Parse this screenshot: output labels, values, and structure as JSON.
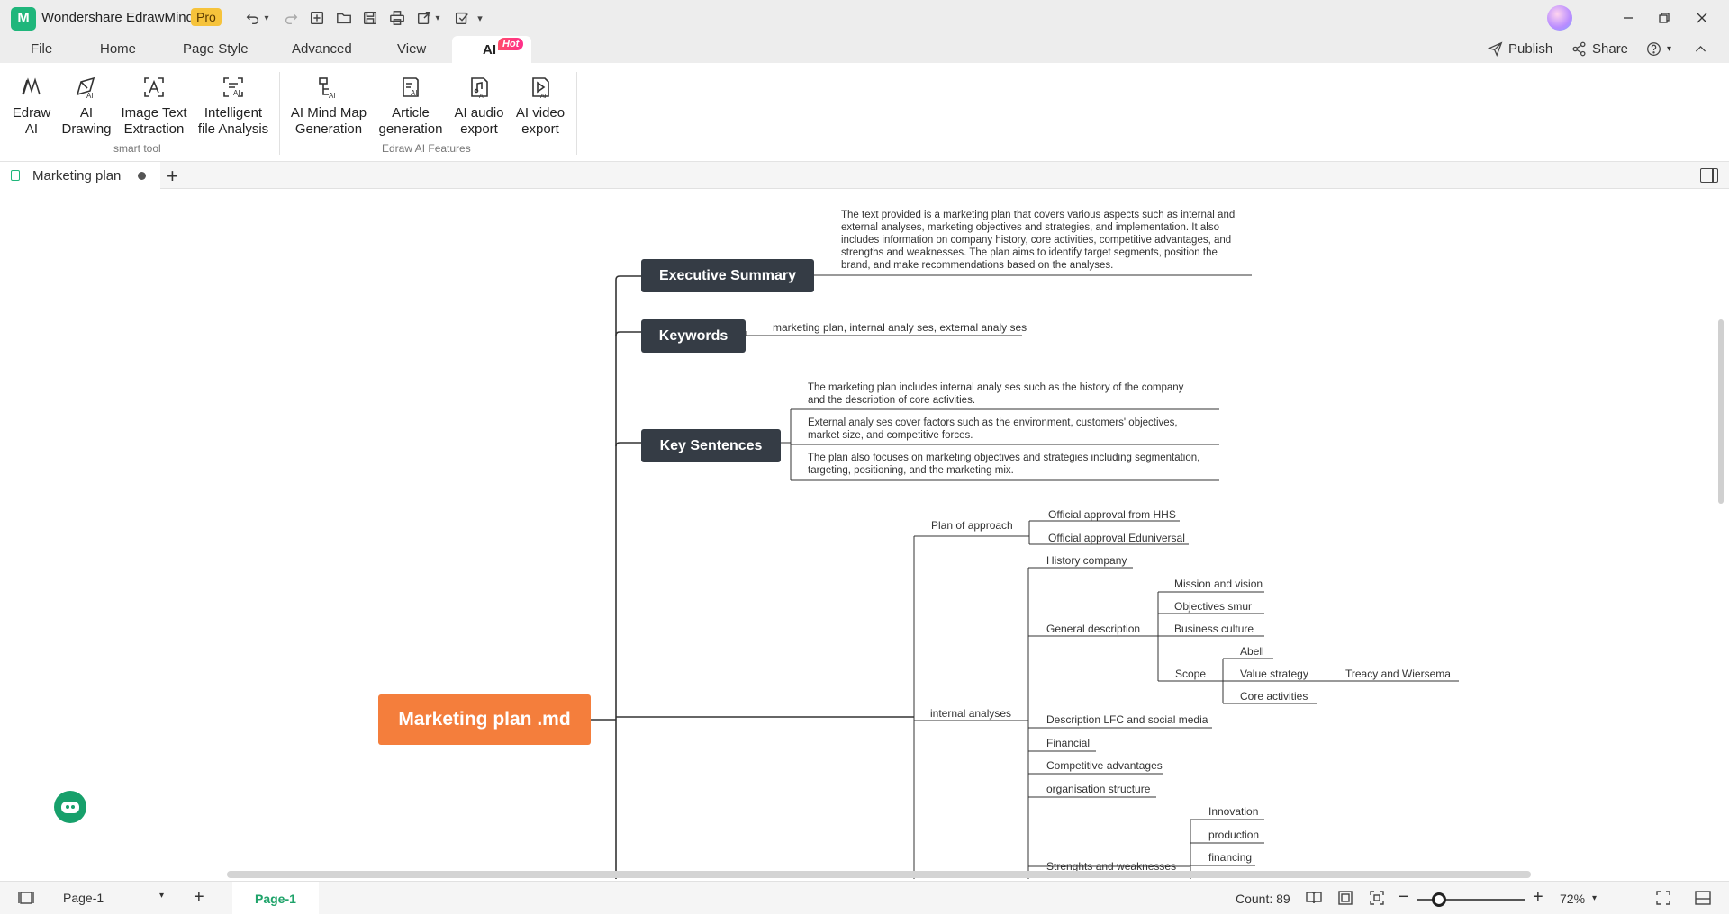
{
  "app": {
    "title": "Wondershare EdrawMind",
    "edition": "Pro",
    "logo_glyph": "M"
  },
  "quick_access": [
    "undo-icon",
    "redo-icon",
    "new-icon",
    "open-icon",
    "save-icon",
    "print-icon",
    "export-icon",
    "checklist-icon",
    "more-icon"
  ],
  "menu": {
    "items": [
      "File",
      "Home",
      "Page Style",
      "Advanced",
      "View"
    ],
    "active": "AI",
    "hot_badge": "Hot",
    "publish": "Publish",
    "share": "Share"
  },
  "ribbon": {
    "groups": [
      {
        "label": "smart tool",
        "buttons": [
          {
            "line1": "Edraw",
            "line2": "AI"
          },
          {
            "line1": "AI",
            "line2": "Drawing"
          },
          {
            "line1": "Image Text",
            "line2": "Extraction"
          },
          {
            "line1": "Intelligent",
            "line2": "file Analysis"
          }
        ]
      },
      {
        "label": "Edraw AI Features",
        "buttons": [
          {
            "line1": "AI Mind Map",
            "line2": "Generation"
          },
          {
            "line1": "Article",
            "line2": "generation"
          },
          {
            "line1": "AI audio",
            "line2": "export"
          },
          {
            "line1": "AI video",
            "line2": "export"
          }
        ]
      }
    ]
  },
  "document_tab": {
    "label": "Marketing plan",
    "add": "+"
  },
  "mindmap": {
    "central": "Marketing plan .md",
    "executive_summary": {
      "label": "Executive Summary",
      "text": [
        "The text provided is a marketing plan that covers various aspects such as internal and",
        "external analyses, marketing objectives and strategies, and implementation. It also",
        "includes information on company history, core activities, competitive advantages, and",
        "strengths and weaknesses. The plan aims to identify target segments, position the",
        "brand, and make recommendations based on the analyses."
      ]
    },
    "keywords": {
      "label": "Keywords",
      "text": "marketing plan, internal analy ses, external analy ses"
    },
    "key_sentences": {
      "label": "Key Sentences",
      "items": [
        [
          "The marketing plan includes internal analy ses such as the history of the company",
          "and the description of core activities."
        ],
        [
          "External analy ses cover factors such as the environment, customers' objectives,",
          "market size, and competitive forces."
        ],
        [
          "The plan also focuses on marketing objectives and strategies including segmentation,",
          "targeting, positioning, and the marketing mix."
        ]
      ]
    },
    "plan_of_approach": {
      "label": "Plan of approach",
      "children": [
        "Official approval from HHS",
        "Official approval Eduniversal"
      ]
    },
    "internal_analyses": {
      "label": "internal analyses",
      "history": "History company",
      "general_description": {
        "label": "General description",
        "children": [
          "Mission and vision",
          "Objectives smur",
          "Business culture"
        ]
      },
      "scope": {
        "label": "Scope",
        "children": [
          "Abell",
          "Value strategy",
          "Core activities"
        ],
        "value_strategy_child": "Treacy and Wiersema"
      },
      "others": [
        "Description LFC and social media",
        "Financial",
        "Competitive advantages",
        "organisation structure"
      ],
      "strengths": {
        "label": "Strenghts and weaknesses",
        "children": [
          "Innovation",
          "production",
          "financing"
        ]
      }
    }
  },
  "statusbar": {
    "page_select": "Page-1",
    "active_page": "Page-1",
    "count": "Count: 89",
    "zoom": "72%"
  }
}
